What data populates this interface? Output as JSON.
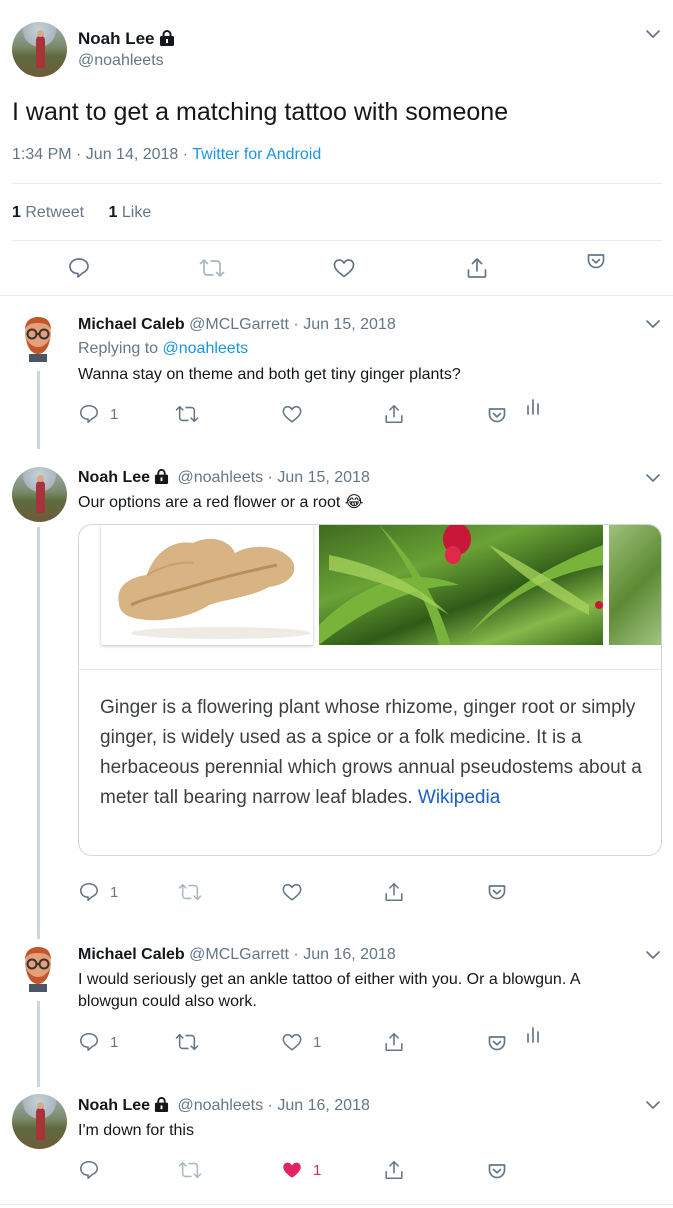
{
  "main_tweet": {
    "name": "Noah Lee",
    "handle": "@noahleets",
    "text": "I want to get a matching tattoo with someone",
    "time": "1:34 PM · Jun 14, 2018 · ",
    "source": "Twitter for Android",
    "retweets_count": "1",
    "retweets_label": "Retweet",
    "likes_count": "1",
    "likes_label": "Like"
  },
  "replies": [
    {
      "name": "Michael Caleb",
      "meta": "@MCLGarrett · Jun 15, 2018",
      "replying_prefix": "Replying to ",
      "replying_to": "@noahleets",
      "text": "Wanna stay on theme and both get tiny ginger plants?",
      "reply_count": "1",
      "retweet_count": "",
      "like_count": ""
    },
    {
      "name": "Noah Lee",
      "meta": "@noahleets · Jun 15, 2018",
      "text": "Our options are a red flower or a root 😂",
      "card": {
        "description": "Ginger is a flowering plant whose rhizome, ginger root or simply ginger, is widely used as a spice or a folk medicine. It is a herbaceous perennial which grows annual pseudostems about a meter tall bearing narrow leaf blades. ",
        "source_link": "Wikipedia"
      },
      "reply_count": "1",
      "retweet_count": "",
      "like_count": ""
    },
    {
      "name": "Michael Caleb",
      "meta": "@MCLGarrett · Jun 16, 2018",
      "text": "I would seriously get an ankle tattoo of either with you. Or a blowgun. A blowgun could also work.",
      "reply_count": "1",
      "retweet_count": "",
      "like_count": "1"
    },
    {
      "name": "Noah Lee",
      "meta": "@noahleets · Jun 16, 2018",
      "text": "I'm down for this",
      "reply_count": "",
      "retweet_count": "",
      "like_count": "1",
      "liked": true
    }
  ],
  "icons": {
    "reply": "reply-icon",
    "retweet": "retweet-icon",
    "like": "heart-icon",
    "share": "share-icon",
    "pocket": "pocket-icon",
    "analytics": "analytics-icon",
    "lock": "lock-icon",
    "chevron": "chevron-down-icon"
  },
  "colors": {
    "link": "#1b95e0",
    "like_active": "#e0245e",
    "text_secondary": "#657786"
  }
}
